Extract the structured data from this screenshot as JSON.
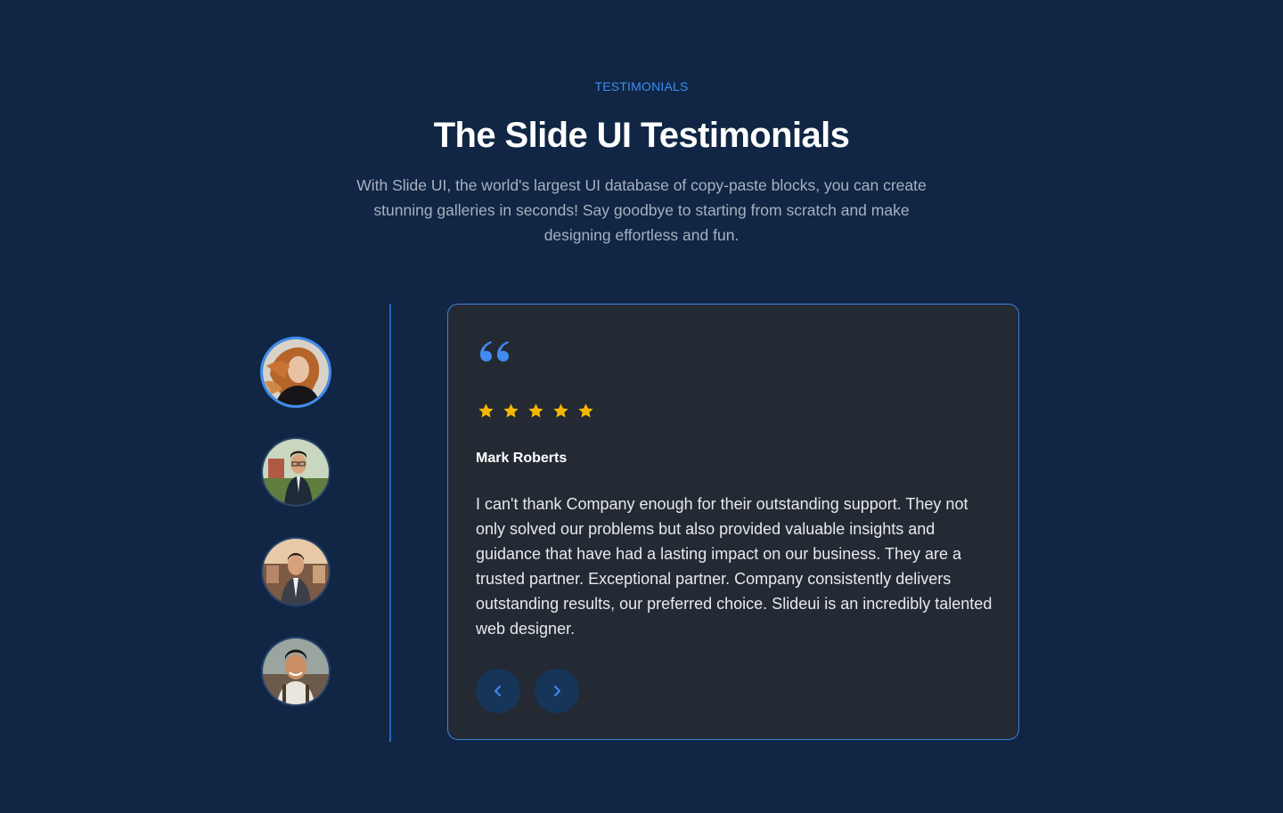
{
  "section": {
    "eyebrow": "TESTIMONIALS",
    "title": "The Slide UI Testimonials",
    "subtitle": "With Slide UI, the world's largest UI database of copy-paste blocks, you can create stunning galleries in seconds! Say goodbye to starting from scratch and make designing effortless and fun."
  },
  "avatars": [
    {
      "icon": "woman-portrait-icon",
      "active": true
    },
    {
      "icon": "man-glasses-portrait-icon",
      "active": false
    },
    {
      "icon": "man-suit-portrait-icon",
      "active": false
    },
    {
      "icon": "smiling-man-portrait-icon",
      "active": false
    }
  ],
  "testimonial": {
    "quote_icon": "quote-mark-icon",
    "rating": 5,
    "rating_max": 5,
    "author": "Mark Roberts",
    "text": "I can't thank Company enough for their outstanding support. They not only solved our problems but also provided valuable insights and guidance that have had a lasting impact on our business. They are a trusted partner. Exceptional partner. Company consistently delivers outstanding results, our preferred choice. Slideui is an incredibly talented web designer."
  },
  "controls": {
    "prev_icon": "chevron-left-icon",
    "next_icon": "chevron-right-icon"
  },
  "colors": {
    "background": "#102644",
    "accent": "#3f8cf0",
    "card": "#242a33",
    "star": "#f5b800"
  }
}
